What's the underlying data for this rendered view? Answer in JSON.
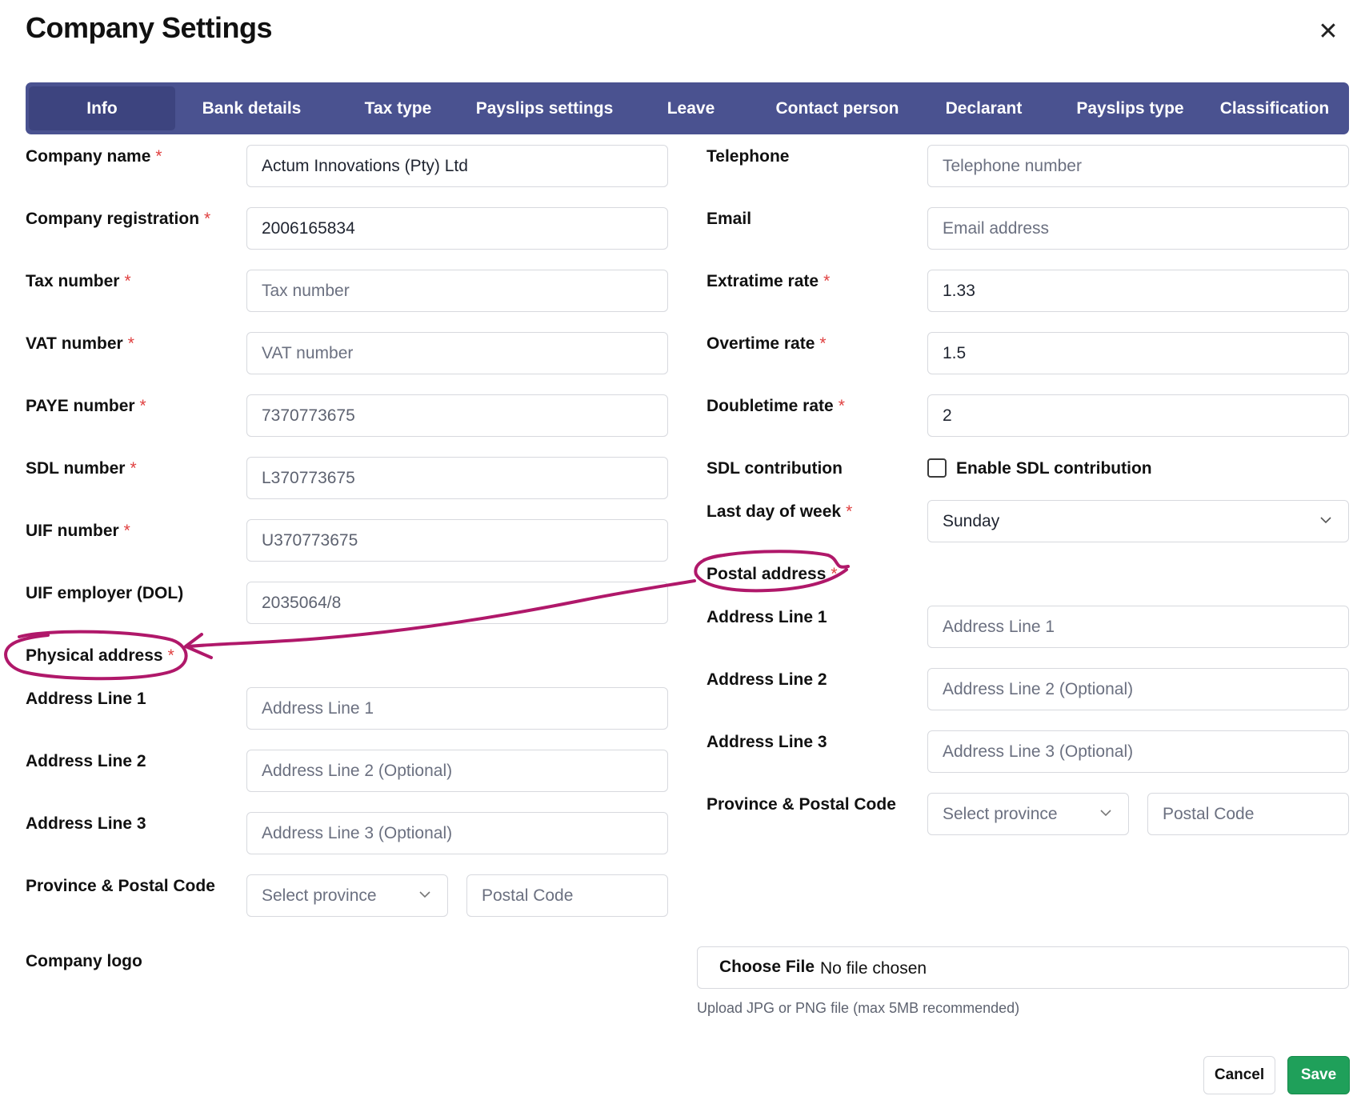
{
  "title": "Company Settings",
  "close_icon": "close-icon",
  "tabs": [
    {
      "label": "Info",
      "active": true
    },
    {
      "label": "Bank details"
    },
    {
      "label": "Tax type"
    },
    {
      "label": "Payslips settings"
    },
    {
      "label": "Leave"
    },
    {
      "label": "Contact person"
    },
    {
      "label": "Declarant"
    },
    {
      "label": "Payslips type"
    },
    {
      "label": "Classification"
    }
  ],
  "required_marker": "*",
  "left": {
    "company_name": {
      "label": "Company name",
      "value": "Actum Innovations (Pty) Ltd"
    },
    "company_registration": {
      "label": "Company registration",
      "value": "2006165834"
    },
    "tax_number": {
      "label": "Tax number",
      "placeholder": "Tax number"
    },
    "vat_number": {
      "label": "VAT number",
      "placeholder": "VAT number"
    },
    "paye_number": {
      "label": "PAYE number",
      "value": "7370773675"
    },
    "sdl_number": {
      "label": "SDL number",
      "value": "L370773675"
    },
    "uif_number": {
      "label": "UIF number",
      "value": "U370773675"
    },
    "uif_employer": {
      "label": "UIF employer (DOL)",
      "value": "2035064/8"
    },
    "physical_address": {
      "heading": "Physical address",
      "line1": {
        "label": "Address Line 1",
        "placeholder": "Address Line 1"
      },
      "line2": {
        "label": "Address Line 2",
        "placeholder": "Address Line 2 (Optional)"
      },
      "line3": {
        "label": "Address Line 3",
        "placeholder": "Address Line 3 (Optional)"
      },
      "province_postal": {
        "label": "Province & Postal Code",
        "province_placeholder": "Select province",
        "postal_placeholder": "Postal Code"
      }
    },
    "company_logo": {
      "label": "Company logo"
    }
  },
  "right": {
    "telephone": {
      "label": "Telephone",
      "placeholder": "Telephone number"
    },
    "email": {
      "label": "Email",
      "placeholder": "Email address"
    },
    "extratime_rate": {
      "label": "Extratime rate",
      "value": "1.33"
    },
    "overtime_rate": {
      "label": "Overtime rate",
      "value": "1.5"
    },
    "doubletime_rate": {
      "label": "Doubletime rate",
      "value": "2"
    },
    "sdl_contribution": {
      "label": "SDL contribution",
      "checkbox_label": "Enable SDL contribution",
      "checked": false
    },
    "last_day_of_week": {
      "label": "Last day of week",
      "value": "Sunday"
    },
    "postal_address": {
      "heading": "Postal address",
      "line1": {
        "label": "Address Line 1",
        "placeholder": "Address Line 1"
      },
      "line2": {
        "label": "Address Line 2",
        "placeholder": "Address Line 2 (Optional)"
      },
      "line3": {
        "label": "Address Line 3",
        "placeholder": "Address Line 3 (Optional)"
      },
      "province_postal": {
        "label": "Province & Postal Code",
        "province_placeholder": "Select province",
        "postal_placeholder": "Postal Code"
      }
    }
  },
  "file_upload": {
    "button": "Choose File",
    "status": "No file chosen",
    "hint": "Upload JPG or PNG file (max 5MB recommended)"
  },
  "footer": {
    "cancel": "Cancel",
    "save": "Save"
  },
  "colors": {
    "tab_bar": "#4a5290",
    "tab_active": "#3d447f",
    "required": "#e04040",
    "save": "#1fa05a",
    "annotation": "#b0186a"
  }
}
